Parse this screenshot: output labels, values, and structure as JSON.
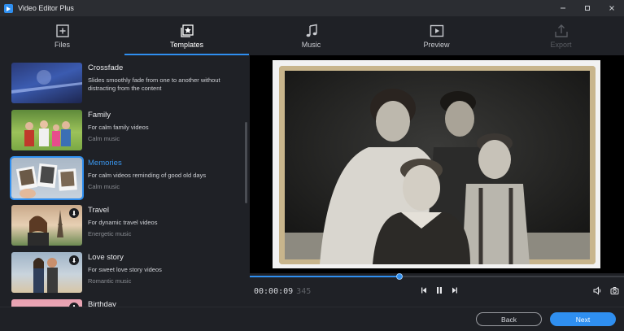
{
  "window": {
    "title": "Video Editor Plus",
    "controls": [
      "minimize-icon",
      "maximize-icon",
      "close-icon"
    ]
  },
  "nav": {
    "tabs": [
      {
        "label": "Files",
        "icon": "files-add-icon",
        "state": "normal"
      },
      {
        "label": "Templates",
        "icon": "templates-star-icon",
        "state": "active"
      },
      {
        "label": "Music",
        "icon": "music-note-icon",
        "state": "normal"
      },
      {
        "label": "Preview",
        "icon": "preview-play-icon",
        "state": "normal"
      },
      {
        "label": "Export",
        "icon": "export-upload-icon",
        "state": "disabled"
      }
    ]
  },
  "templates": {
    "items": [
      {
        "name": "Crossfade",
        "description": "Slides smoothly fade from one to another without distracting from the content",
        "music": "",
        "download": false,
        "selected": false
      },
      {
        "name": "Family",
        "description": "For calm family videos",
        "music": "Calm music",
        "download": false,
        "selected": false
      },
      {
        "name": "Memories",
        "description": "For calm videos reminding of good old days",
        "music": "Calm music",
        "download": false,
        "selected": true
      },
      {
        "name": "Travel",
        "description": "For dynamic travel videos",
        "music": "Energetic music",
        "download": true,
        "selected": false
      },
      {
        "name": "Love story",
        "description": "For sweet love story videos",
        "music": "Romantic music",
        "download": true,
        "selected": false
      },
      {
        "name": "Birthday",
        "description": "",
        "music": "",
        "download": true,
        "selected": false
      }
    ]
  },
  "player": {
    "timecode": "00:00:09",
    "frames": "345",
    "progress": 0.4
  },
  "footer": {
    "back_label": "Back",
    "next_label": "Next"
  },
  "colors": {
    "accent": "#2f8ff0",
    "background": "#1f2126",
    "titlebar": "#2b2d32"
  }
}
